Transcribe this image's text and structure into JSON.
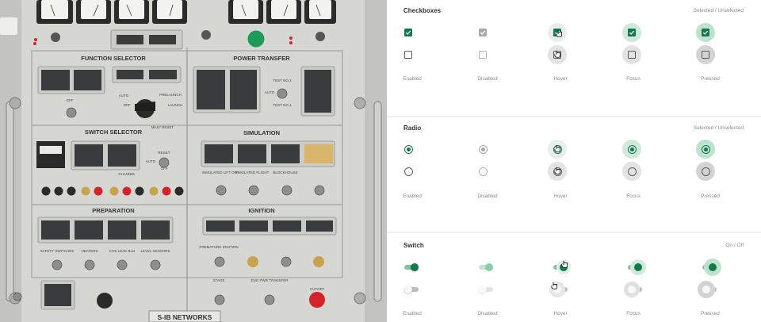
{
  "photo": {
    "panel_titles": {
      "function_selector": "FUNCTION SELECTOR",
      "power_transfer": "POWER TRANSFER",
      "switch_selector": "SWITCH SELECTOR",
      "simulation": "SIMULATION",
      "preparation": "PREPARATION",
      "ignition": "IGNITION",
      "brand": "S-IB NETWORKS"
    },
    "labels": {
      "auto": "AUTO",
      "off": "OFF",
      "prelaunch": "PRELAUNCH",
      "launch": "LAUNCH",
      "malf_reset": "MALF RESET",
      "test_no2": "TEST NO.2",
      "test_no1": "TEST NO.1",
      "channel": "CHANNEL",
      "reset": "RESET",
      "safety_switches": "SAFETY SWITCHES",
      "heaters": "HEATERS",
      "cos_leak_bld": "COS LEAK BLD",
      "level_sensors": "LEVEL SENSORS",
      "premature_ignition": "PREMATURE IGNITION",
      "stage": "STAGE",
      "eng_pwr_transfer": "ENG PWR TRANSFER",
      "sim_lift_off": "SIMULATED LIFT OFF",
      "sim_flight": "SIMULATED FLIGHT",
      "blockhouse": "BLOCKHOUSE",
      "cutoff": "CUTOFF"
    },
    "colors": {
      "panel": "#d6d7d2",
      "panel_dark": "#c8c9c4",
      "frame": "#bdbdb8",
      "indicator": "#1e9a5a",
      "lamp_red": "#d3232b",
      "text": "#333333"
    }
  },
  "spec": {
    "colors": {
      "accent": "#107a4a",
      "label": "#8a8a8a",
      "title": "#333333",
      "divider": "#ececec"
    },
    "columns": [
      "Enabled",
      "Disabled",
      "Hover",
      "Focus",
      "Pressed"
    ],
    "sections": {
      "checkboxes": {
        "title": "Checkboxes",
        "subtitle": "Selected / Unselected"
      },
      "radio": {
        "title": "Radio",
        "subtitle": "Selected / Unselected"
      },
      "switch": {
        "title": "Switch",
        "subtitle": "On / Off"
      }
    },
    "icons": {
      "checkmark": "check-icon",
      "pointer": "hand-pointer-icon"
    }
  }
}
